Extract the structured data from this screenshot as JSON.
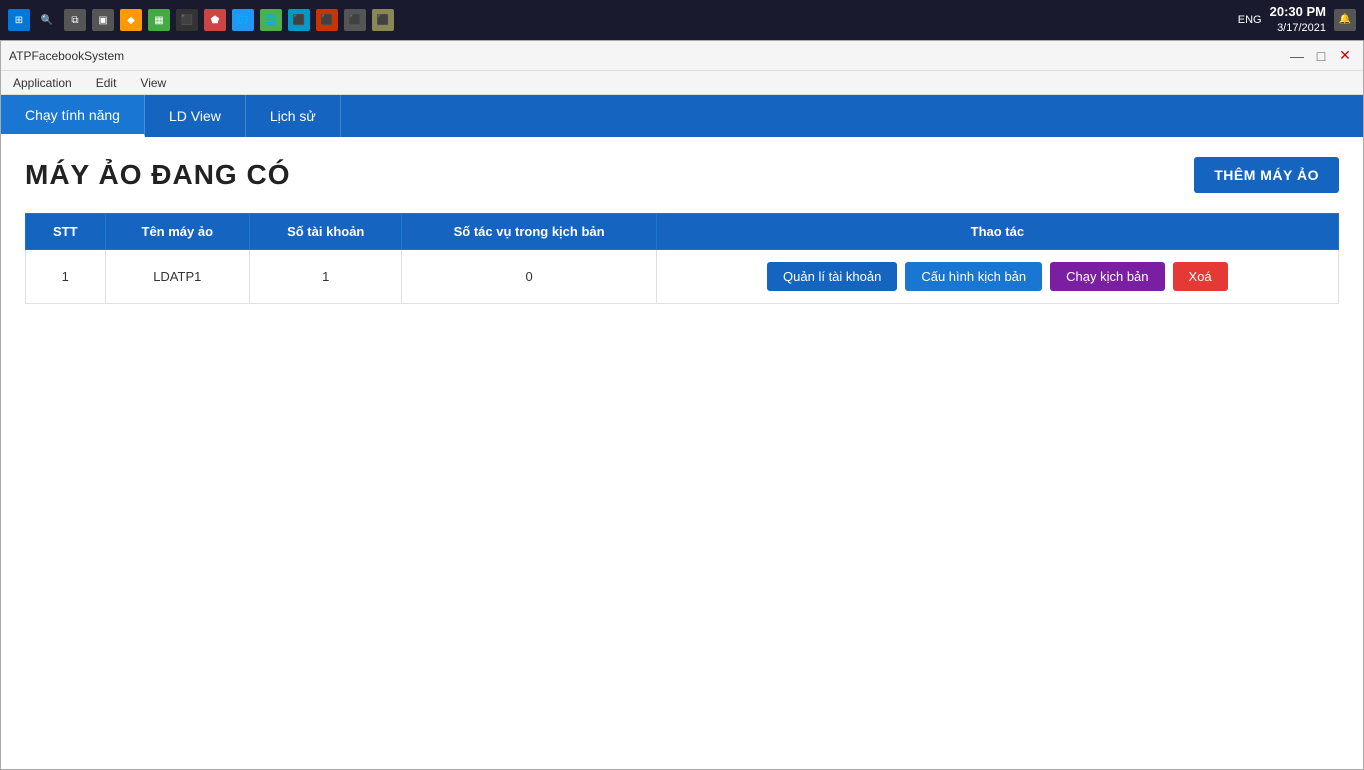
{
  "taskbar": {
    "time": "20:30 PM",
    "date": "3/17/2021",
    "lang": "ENG"
  },
  "window": {
    "title": "ATPFacebookSystem",
    "min_label": "—",
    "max_label": "□",
    "close_label": "✕"
  },
  "menubar": {
    "items": [
      "Application",
      "Edit",
      "View"
    ]
  },
  "tabs": [
    {
      "id": "chay-tinh-nang",
      "label": "Chạy tính năng",
      "active": true
    },
    {
      "id": "ld-view",
      "label": "LD View",
      "active": false
    },
    {
      "id": "lich-su",
      "label": "Lịch sử",
      "active": false
    }
  ],
  "page": {
    "title": "MÁY ẢO ĐANG CÓ",
    "add_button_label": "THÊM MÁY ẢO"
  },
  "table": {
    "headers": [
      "STT",
      "Tên máy ảo",
      "Số tài khoản",
      "Số tác vụ trong kịch bản",
      "Thao tác"
    ],
    "rows": [
      {
        "stt": "1",
        "name": "LDATP1",
        "accounts": "1",
        "tasks": "0",
        "actions": {
          "manage": "Quản lí tài khoản",
          "config": "Cấu hình kịch bản",
          "run": "Chạy kịch bản",
          "delete": "Xoá"
        }
      }
    ]
  }
}
